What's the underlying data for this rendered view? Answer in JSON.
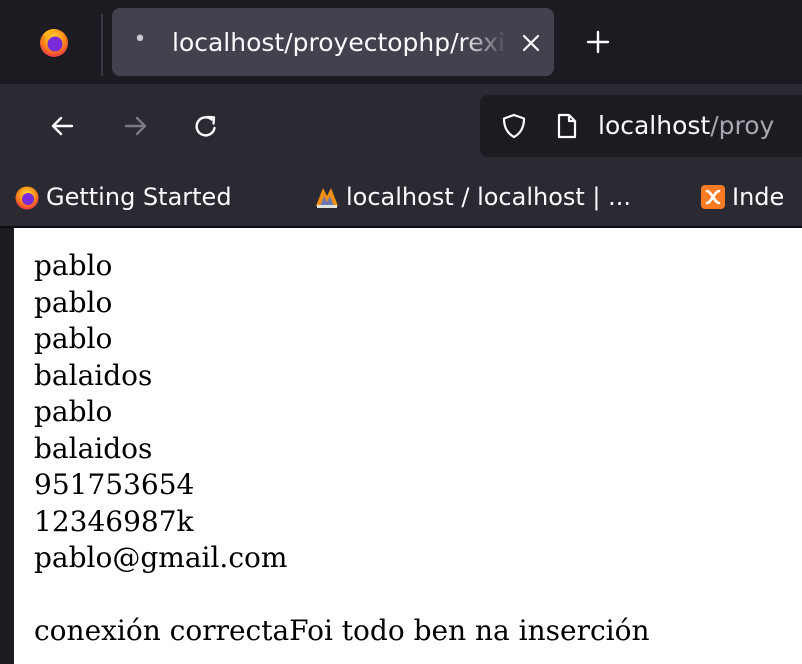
{
  "browser": {
    "tab": {
      "title": "localhost/proyectophp/rexistro.php"
    },
    "urlbar": {
      "host": "localhost",
      "path": "/proy"
    },
    "bookmarks": [
      {
        "label": "Getting Started",
        "icon": "firefox-icon"
      },
      {
        "label": "localhost / localhost | ...",
        "icon": "phpmyadmin-icon"
      },
      {
        "label": "Inde",
        "icon": "xampp-icon"
      }
    ],
    "colors": {
      "chrome_dark": "#1c1b22",
      "chrome_toolbar": "#2b2a33",
      "tab_active": "#42414d",
      "text": "#fbfbfe"
    }
  },
  "page": {
    "lines": [
      "pablo",
      "pablo",
      "pablo",
      "balaidos",
      "pablo",
      "balaidos",
      "951753654",
      "12346987k",
      "pablo@gmail.com"
    ],
    "message": "conexión correctaFoi todo ben na inserción"
  }
}
